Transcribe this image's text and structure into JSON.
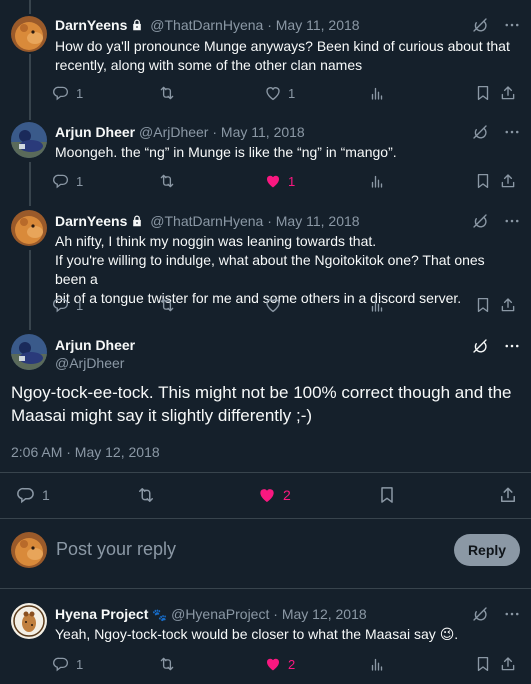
{
  "tweets": [
    {
      "name": "DarnYeens",
      "protected": true,
      "handle": "@ThatDarnHyena",
      "date": "May 11, 2018",
      "lines": [
        "How do ya'll pronounce Munge anyways? Been kind of curious about that",
        "recently, along with some of the other clan names"
      ],
      "replies": "1",
      "likes": "1",
      "liked": false
    },
    {
      "name": "Arjun Dheer",
      "protected": false,
      "handle": "@ArjDheer",
      "date": "May 11, 2018",
      "lines": [
        "Moongeh. the “ng” in Munge is like the “ng” in “mango”."
      ],
      "replies": "1",
      "likes": "1",
      "liked": true
    },
    {
      "name": "DarnYeens",
      "protected": true,
      "handle": "@ThatDarnHyena",
      "date": "May 11, 2018",
      "lines": [
        "Ah nifty, I think my noggin was leaning towards that.",
        "If you're willing to indulge, what about the Ngoitokitok one? That ones been a",
        "bit of a tongue twister for me and some others in a discord server."
      ],
      "replies": "1",
      "likes": "",
      "liked": false
    }
  ],
  "separator": " · ",
  "focal": {
    "name": "Arjun Dheer",
    "handle": "@ArjDheer",
    "text": "Ngoy-tock-ee-tock. This might not be 100% correct though and the Maasai might say it slightly differently ;-)",
    "timestamp": "2:06 AM · May 12, 2018",
    "replies": "1",
    "likes": "2",
    "liked": true
  },
  "reply_box": {
    "placeholder": "Post your reply",
    "button": "Reply"
  },
  "reply_tweet": {
    "name": "Hyena Project",
    "badge_emoji": "🐾",
    "handle": "@HyenaProject",
    "date": "May 12, 2018",
    "text": "Yeah, Ngoy-tock-tock would be closer to what the Maasai say",
    "emoji": "😉",
    "replies": "1",
    "likes": "2",
    "liked": true
  },
  "icons": {
    "reply": "reply-icon",
    "repost": "repost-icon",
    "like": "heart-icon",
    "views": "views-icon",
    "bookmark": "bookmark-icon",
    "share": "share-icon",
    "grok": "grok-icon",
    "more": "more-icon",
    "protected": "lock-icon"
  },
  "colors": {
    "background": "#15202b",
    "text": "#f7f9f9",
    "secondary": "#8b98a5",
    "like": "#f91880",
    "divider": "#38444d"
  }
}
